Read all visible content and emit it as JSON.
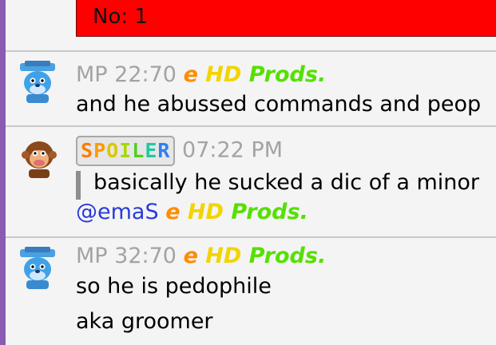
{
  "banner": {
    "text": "No: 1"
  },
  "messages": [
    {
      "avatar": "blue-bear-avatar",
      "time": "MP 22:70",
      "name": [
        "e",
        "HD",
        "Prods."
      ],
      "lines": [
        "and he abussed commands and peop"
      ]
    },
    {
      "avatar": "monkey-avatar",
      "badge": [
        "S",
        "P",
        "O",
        "I",
        "L",
        "E",
        "R"
      ],
      "time": "07:22 PM",
      "quote": "basically he sucked a dic of a minor",
      "mention": "@emaS",
      "mention_name": [
        "e",
        "HD",
        "Prods."
      ]
    },
    {
      "avatar": "blue-bear-avatar",
      "time": "MP 32:70",
      "name": [
        "e",
        "HD",
        "Prods."
      ],
      "lines": [
        "so he is pedophile",
        "aka groomer"
      ]
    }
  ],
  "colors": {
    "banner": "#ff0000",
    "name_gradient": [
      "#ff8c00",
      "#f2d400",
      "#55e000"
    ],
    "mention": "#2a3bd8",
    "badge_letters": [
      "#ff7a00",
      "#ff9a00",
      "#d8c800",
      "#a6d800",
      "#50d020",
      "#20c8a0",
      "#3080f0"
    ]
  }
}
